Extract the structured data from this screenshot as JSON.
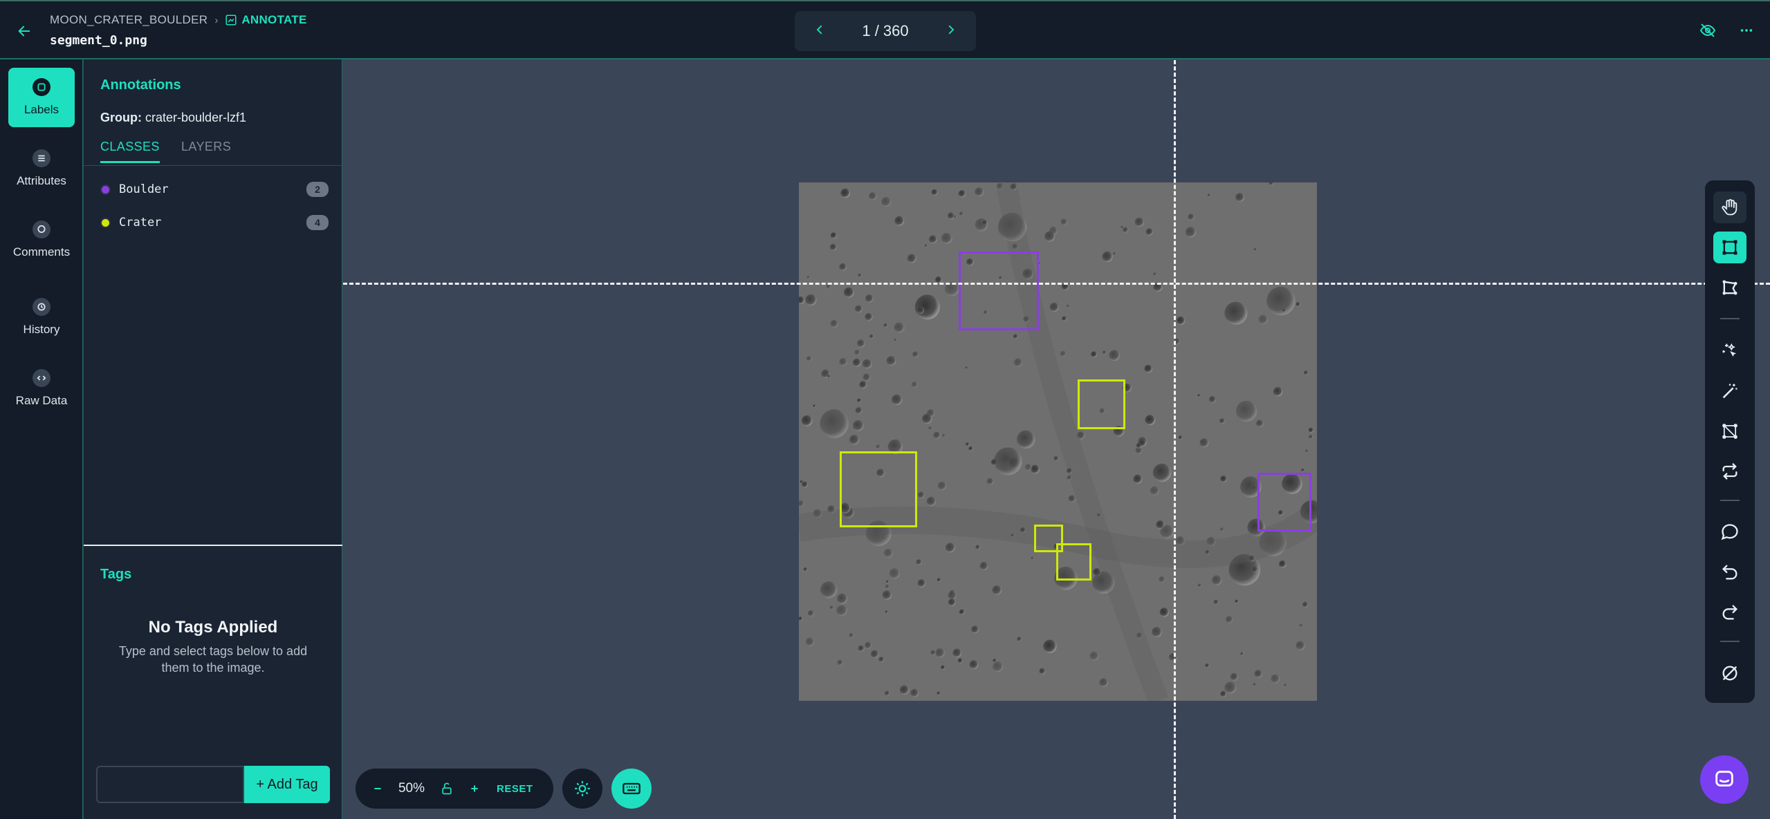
{
  "header": {
    "project": "MOON_CRATER_BOULDER",
    "mode": "ANNOTATE",
    "filename": "segment_0.png",
    "pager": {
      "current": "1 / 360"
    }
  },
  "rail": {
    "items": [
      {
        "label": "Labels",
        "icon": "tag-icon",
        "active": true
      },
      {
        "label": "Attributes",
        "icon": "list-icon",
        "active": false
      },
      {
        "label": "Comments",
        "icon": "comment-icon",
        "active": false
      },
      {
        "label": "History",
        "icon": "history-icon",
        "active": false
      },
      {
        "label": "Raw Data",
        "icon": "code-icon",
        "active": false
      }
    ]
  },
  "panel": {
    "title": "Annotations",
    "group_label": "Group:",
    "group_value": "crater-boulder-lzf1",
    "tabs": [
      {
        "label": "CLASSES",
        "active": true
      },
      {
        "label": "LAYERS",
        "active": false
      }
    ],
    "classes": [
      {
        "name": "Boulder",
        "count": "2",
        "color": "#8a3fe0"
      },
      {
        "name": "Crater",
        "count": "4",
        "color": "#cfe80a"
      }
    ],
    "tags": {
      "title": "Tags",
      "empty_heading": "No Tags Applied",
      "empty_text": "Type and select tags below to add them to the image.",
      "input_value": "",
      "add_label": "+ Add Tag"
    }
  },
  "zoom": {
    "value": "50%",
    "reset_label": "RESET"
  },
  "colors": {
    "accent": "#1ee0c0",
    "boulder": "#8a3fe0",
    "crater": "#cfe80a",
    "chat": "#7a3ff2"
  }
}
